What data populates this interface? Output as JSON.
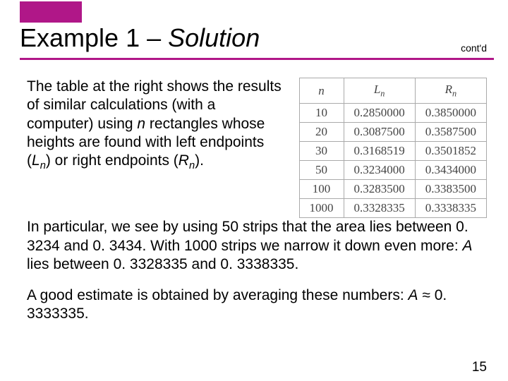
{
  "header": {
    "title_plain": "Example 1 – ",
    "title_italic": "Solution",
    "contd": "cont'd"
  },
  "para1_a": "The table at the right shows the results of similar calculations (with a computer) using ",
  "para1_n": "n",
  "para1_b": " rectangles whose heights are found with left endpoints (",
  "para1_L": "L",
  "para1_Ln": "n",
  "para1_c": ") or right endpoints (",
  "para1_R": "R",
  "para1_Rn": "n",
  "para1_d": ").",
  "para2": "In particular, we see by using 50 strips that the area lies between 0. 3234 and 0. 3434. With 1000 strips we narrow it down even more: ",
  "para2_A": "A",
  "para2_b": " lies between 0. 3328335 and 0. 3338335.",
  "para3_a": "A good estimate is obtained by averaging these numbers: ",
  "para3_A": "A",
  "para3_b": " ≈ 0. 3333335.",
  "chart_data": {
    "type": "table",
    "columns": [
      "n",
      "Lₙ",
      "Rₙ"
    ],
    "rows": [
      {
        "n": "10",
        "L": "0.2850000",
        "R": "0.3850000"
      },
      {
        "n": "20",
        "L": "0.3087500",
        "R": "0.3587500"
      },
      {
        "n": "30",
        "L": "0.3168519",
        "R": "0.3501852"
      },
      {
        "n": "50",
        "L": "0.3234000",
        "R": "0.3434000"
      },
      {
        "n": "100",
        "L": "0.3283500",
        "R": "0.3383500"
      },
      {
        "n": "1000",
        "L": "0.3328335",
        "R": "0.3338335"
      }
    ]
  },
  "page_number": "15"
}
